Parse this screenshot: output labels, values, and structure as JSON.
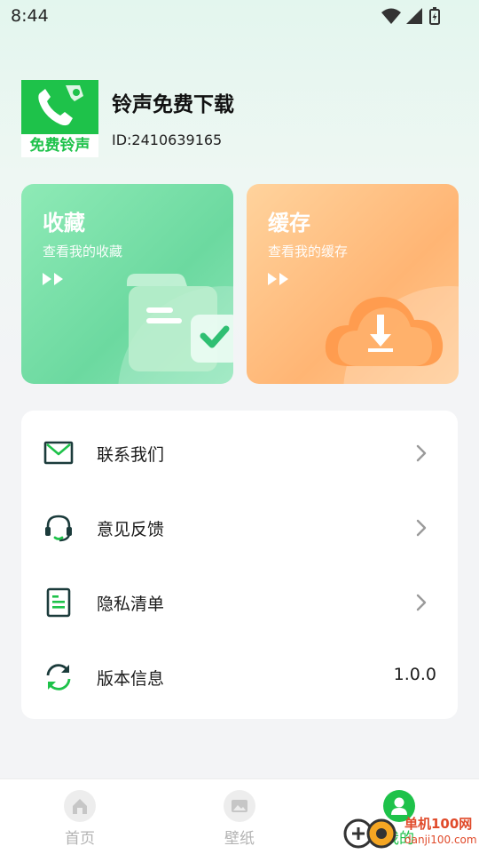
{
  "status": {
    "time": "8:44"
  },
  "profile": {
    "name": "铃声免费下载",
    "id_text": "ID:2410639165",
    "logo_text": "免费铃声"
  },
  "cards": [
    {
      "title": "收藏",
      "subtitle": "查看我的收藏",
      "icon": "folder-check-icon"
    },
    {
      "title": "缓存",
      "subtitle": "查看我的缓存",
      "icon": "cloud-download-icon"
    }
  ],
  "menu": {
    "items": [
      {
        "label": "联系我们",
        "icon": "mail-icon"
      },
      {
        "label": "意见反馈",
        "icon": "headset-icon"
      },
      {
        "label": "隐私清单",
        "icon": "document-list-icon"
      },
      {
        "label": "版本信息",
        "icon": "refresh-icon",
        "value": "1.0.0"
      }
    ]
  },
  "tabs": [
    {
      "label": "首页",
      "icon": "home-icon"
    },
    {
      "label": "壁纸",
      "icon": "image-icon"
    },
    {
      "label": "我的",
      "icon": "user-icon",
      "active": true
    }
  ],
  "watermark": {
    "text": "单机100网",
    "sub": "danji100.com"
  },
  "colors": {
    "accent": "#1ec24a",
    "fav_card": "#7ee0aa",
    "cache_card": "#ffbe80",
    "inactive": "#b3b3b3"
  }
}
